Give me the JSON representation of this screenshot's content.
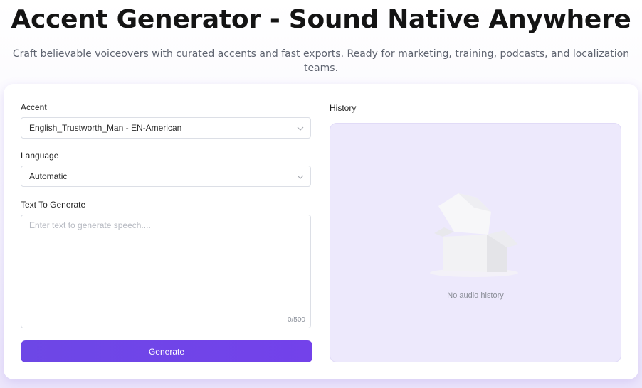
{
  "hero": {
    "title": "Accent Generator - Sound Native Anywhere",
    "subtitle": "Craft believable voiceovers with curated accents and fast exports. Ready for marketing, training, podcasts, and localization teams."
  },
  "form": {
    "accent_label": "Accent",
    "accent_value": "English_Trustworth_Man - EN-American",
    "language_label": "Language",
    "language_value": "Automatic",
    "text_label": "Text To Generate",
    "text_placeholder": "Enter text to generate speech....",
    "text_value": "",
    "char_counter": "0/500",
    "generate_label": "Generate"
  },
  "history": {
    "title": "History",
    "empty_text": "No audio history",
    "empty_icon": "empty-box-icon"
  },
  "colors": {
    "accent": "#6d47e6",
    "history_bg": "#ede9fc"
  }
}
